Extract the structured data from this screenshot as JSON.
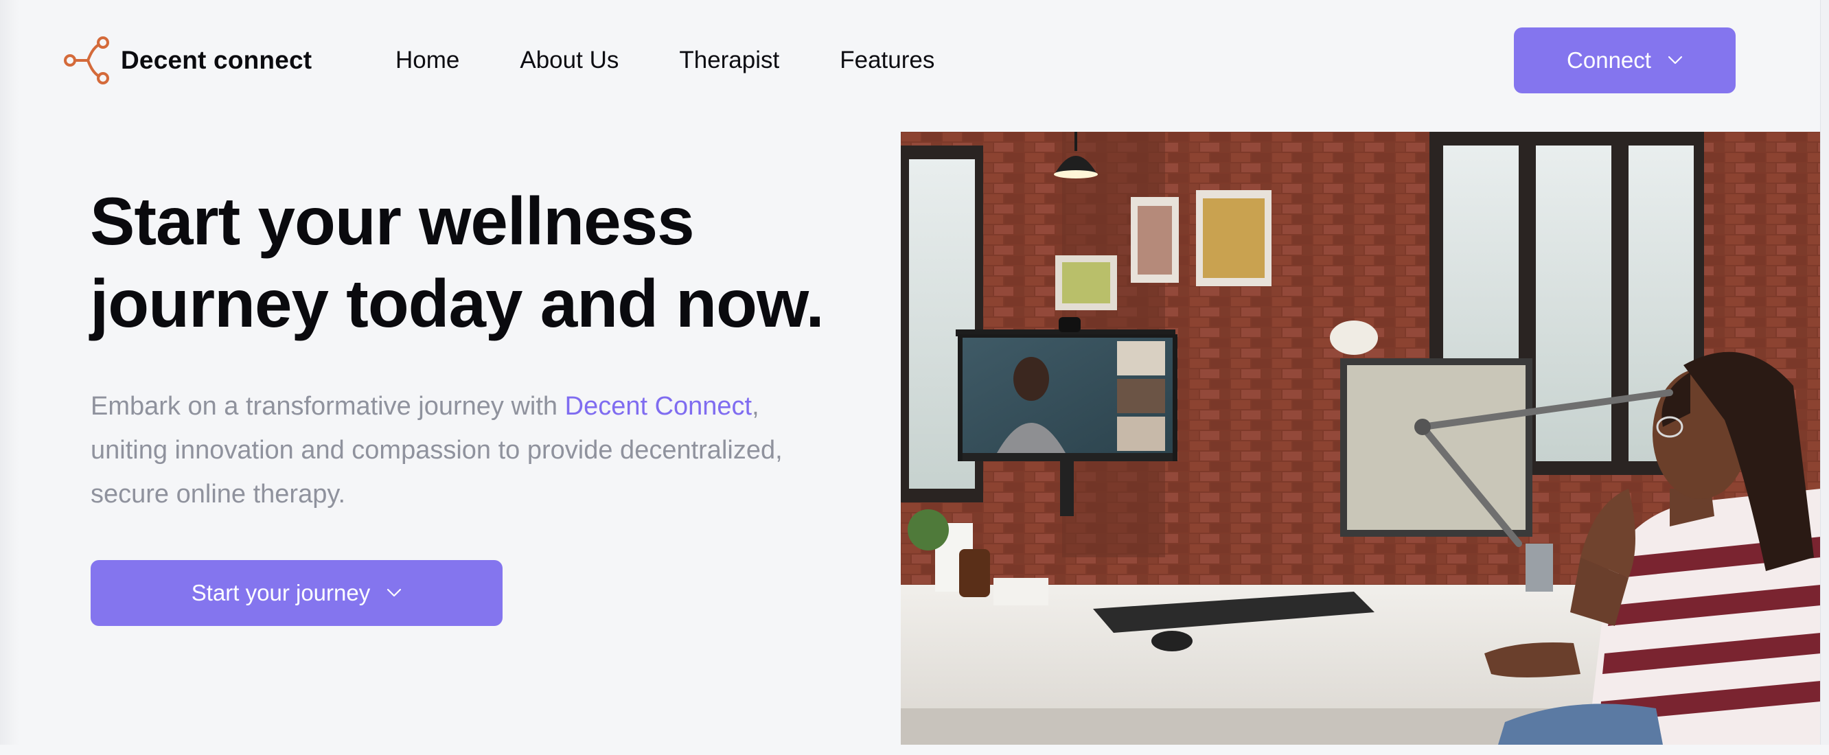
{
  "brand": {
    "name": "Decent connect",
    "logo_icon": "network-node-icon",
    "logo_color": "#d46a3a"
  },
  "nav": {
    "items": [
      {
        "label": "Home"
      },
      {
        "label": "About Us"
      },
      {
        "label": "Therapist"
      },
      {
        "label": "Features"
      }
    ]
  },
  "header": {
    "connect_label": "Connect",
    "connect_icon": "chevron-down-icon"
  },
  "hero": {
    "title": "Start your wellness journey today and now.",
    "description_before": "Embark on a transformative journey with ",
    "description_brand": "Decent Connect",
    "description_after": ", uniting innovation and compassion to provide decentralized, secure online therapy.",
    "cta_label": "Start your journey",
    "cta_icon": "chevron-down-icon",
    "image_subject": "woman-on-video-therapy-call-photo"
  },
  "colors": {
    "accent": "#8475ee",
    "brand_text": "#7f6cf0",
    "background": "#f5f6f8",
    "muted_text": "#8f929d"
  }
}
